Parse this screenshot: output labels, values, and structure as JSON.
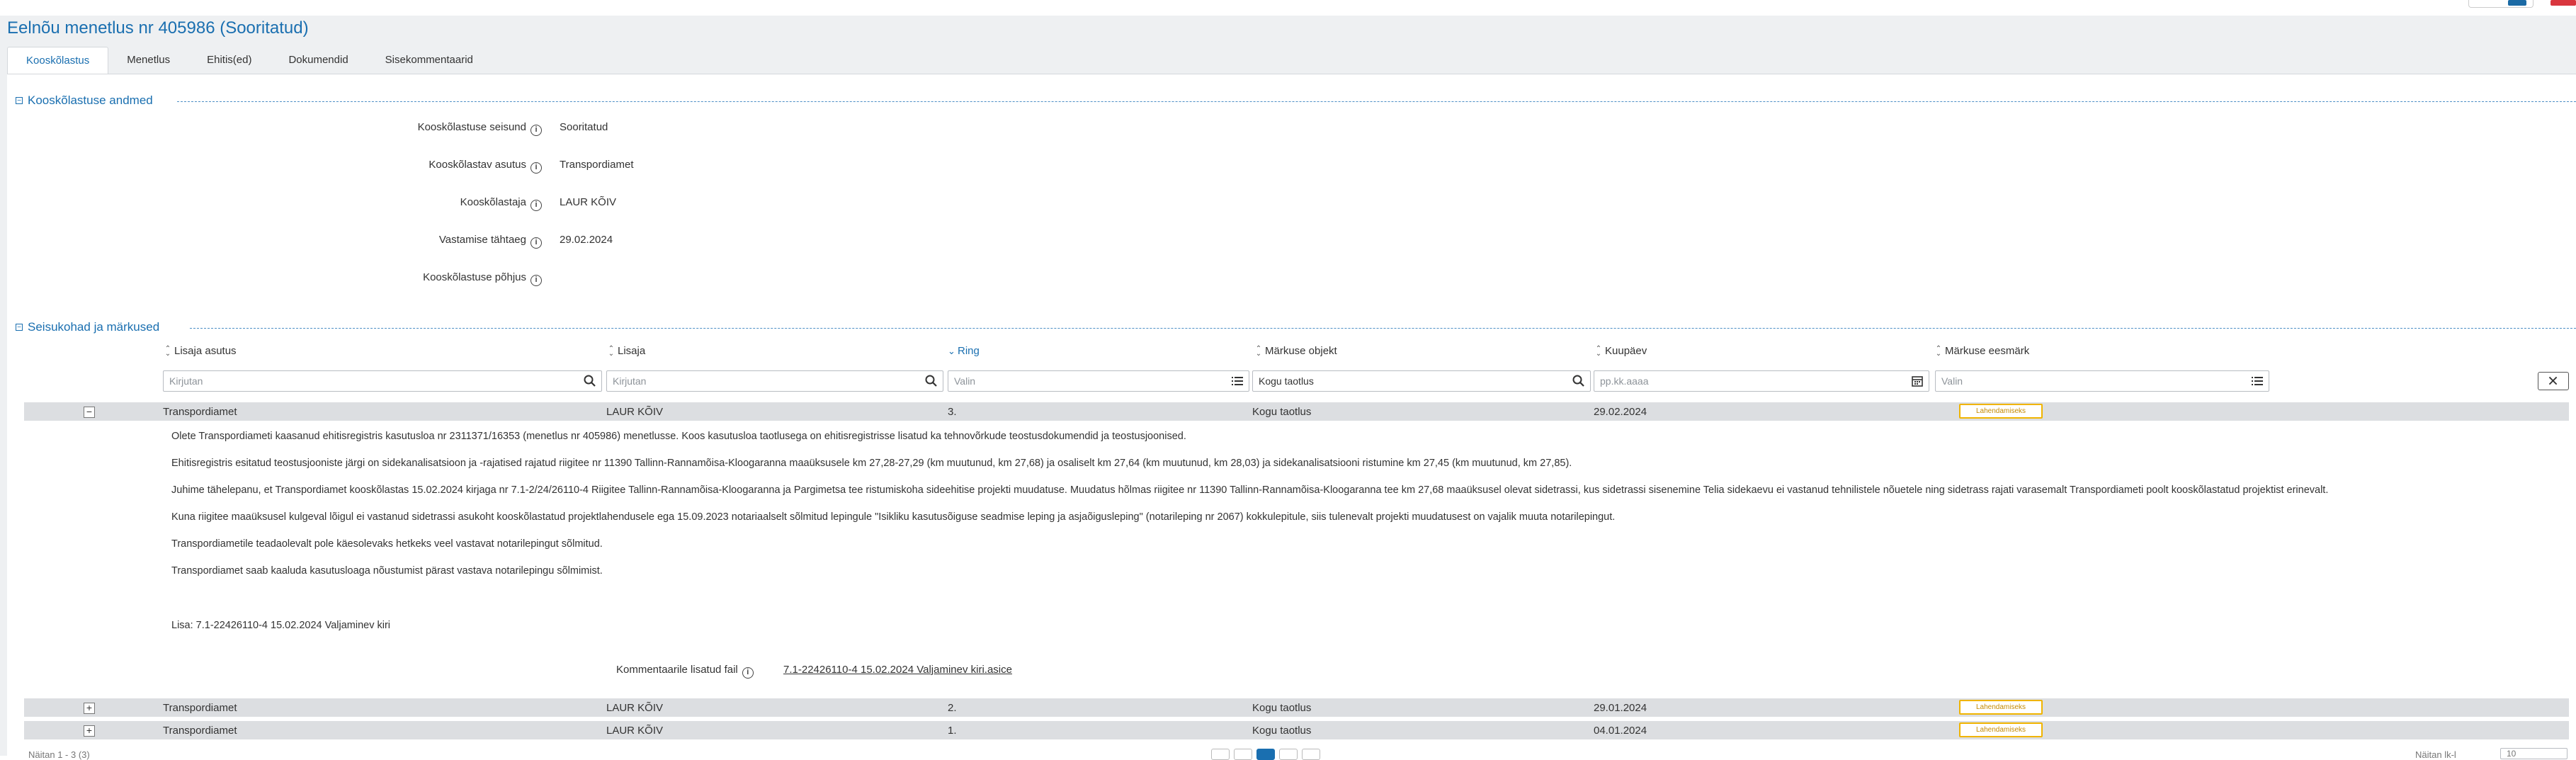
{
  "page": {
    "title": "Eelnõu menetlus nr 405986 (Sooritatud)"
  },
  "tabs": [
    {
      "label": "Kooskõlastus",
      "active": true
    },
    {
      "label": "Menetlus",
      "active": false
    },
    {
      "label": "Ehitis(ed)",
      "active": false
    },
    {
      "label": "Dokumendid",
      "active": false
    },
    {
      "label": "Sisekommentaarid",
      "active": false
    }
  ],
  "section1": {
    "title": "Kooskõlastuse andmed",
    "fields": [
      {
        "label": "Kooskõlastuse seisund",
        "value": "Sooritatud"
      },
      {
        "label": "Kooskõlastav asutus",
        "value": "Transpordiamet"
      },
      {
        "label": "Kooskõlastaja",
        "value": "LAUR KÕIV"
      },
      {
        "label": "Vastamise tähtaeg",
        "value": "29.02.2024"
      },
      {
        "label": "Kooskõlastuse põhjus",
        "value": ""
      }
    ]
  },
  "section2": {
    "title": "Seisukohad ja märkused",
    "columns": [
      {
        "label": "Lisaja asutus"
      },
      {
        "label": "Lisaja"
      },
      {
        "label": "Ring"
      },
      {
        "label": "Märkuse objekt"
      },
      {
        "label": "Kuupäev"
      },
      {
        "label": "Märkuse eesmärk"
      }
    ],
    "filters": {
      "asutus_placeholder": "Kirjutan",
      "lisaja_placeholder": "Kirjutan",
      "ring_placeholder": "Valin",
      "objekt_value": "Kogu taotlus",
      "kuupaev_placeholder": "pp.kk.aaaa",
      "eesmark_placeholder": "Valin"
    },
    "rows": [
      {
        "asutus": "Transpordiamet",
        "lisaja": "LAUR KÕIV",
        "ring": "3.",
        "objekt": "Kogu taotlus",
        "kuupaev": "29.02.2024",
        "eesmark": "Lahendamiseks",
        "expanded": true,
        "toggle": "−"
      },
      {
        "asutus": "Transpordiamet",
        "lisaja": "LAUR KÕIV",
        "ring": "2.",
        "objekt": "Kogu taotlus",
        "kuupaev": "29.01.2024",
        "eesmark": "Lahendamiseks",
        "expanded": false,
        "toggle": "+"
      },
      {
        "asutus": "Transpordiamet",
        "lisaja": "LAUR KÕIV",
        "ring": "1.",
        "objekt": "Kogu taotlus",
        "kuupaev": "04.01.2024",
        "eesmark": "Lahendamiseks",
        "expanded": false,
        "toggle": "+"
      }
    ],
    "comment": {
      "paragraphs": [
        "Olete Transpordiameti kaasanud ehitisregistris kasutusloa nr 2311371/16353 (menetlus nr 405986) menetlusse. Koos kasutusloa taotlusega on ehitisregistrisse lisatud ka tehnovõrkude teostusdokumendid ja teostusjoonised.",
        "Ehitisregistris esitatud teostusjooniste järgi on sidekanalisatsioon ja -rajatised rajatud riigitee nr 11390 Tallinn-Rannamõisa-Kloogaranna maaüksusele km 27,28-27,29 (km muutunud, km 27,68) ja osaliselt km 27,64 (km muutunud, km 28,03) ja sidekanalisatsiooni ristumine km 27,45 (km muutunud, km 27,85).",
        "Juhime tähelepanu, et Transpordiamet kooskõlastas 15.02.2024 kirjaga nr 7.1-2/24/26110-4 Riigitee Tallinn-Rannamõisa-Kloogaranna ja Pargimetsa tee ristumiskoha sideehitise projekti muudatuse. Muudatus hõlmas riigitee nr 11390 Tallinn-Rannamõisa-Kloogaranna tee km 27,68 maaüksusel olevat sidetrassi, kus sidetrassi sisenemine Telia sidekaevu ei vastanud tehnilistele nõuetele ning sidetrass rajati varasemalt Transpordiameti poolt kooskõlastatud projektist erinevalt.",
        "Kuna riigitee maaüksusel kulgeval lõigul ei vastanud sidetrassi asukoht kooskõlastatud projektlahendusele ega 15.09.2023 notariaalselt sõlmitud lepingule \"Isikliku kasutusõiguse seadmise leping ja asjaõigusleping\" (notarileping nr 2067) kokkulepitule, siis tulenevalt projekti muudatusest on vajalik muuta notarilepingut.",
        "Transpordiametile teadaolevalt pole käesolevaks hetkeks veel vastavat notarilepingut sõlmitud.",
        "Transpordiamet saab kaaluda kasutusloaga nõustumist pärast vastava notarilepingu sõlmimist.",
        "Lisa: 7.1-22426110-4 15.02.2024 Valjaminev kiri"
      ],
      "attachment_label": "Kommentaarile lisatud fail",
      "attachment_link": "7.1-22426110-4 15.02.2024 Valjaminev kiri.asice"
    }
  },
  "footer": {
    "left": "Näitan 1 - 3 (3)",
    "right": "Näitan lk-l",
    "pagesize": "10"
  },
  "colors": {
    "accent": "#1a6fb0",
    "badge_border": "#f0b400",
    "row_bg": "#dcdee1"
  }
}
